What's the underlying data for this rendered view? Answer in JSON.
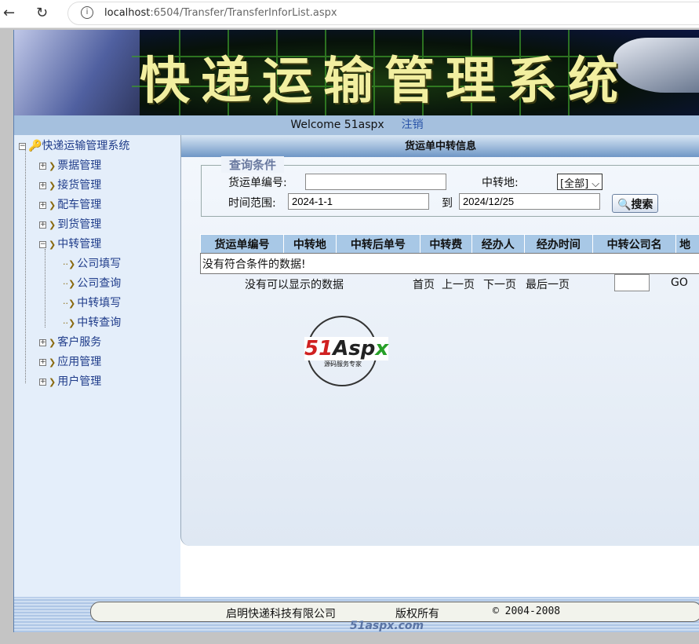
{
  "browser": {
    "url_host": "localhost",
    "url_path": ":6504/Transfer/TransferInforList.aspx"
  },
  "banner": {
    "title": "快递运输管理系统"
  },
  "welcome": {
    "text": "Welcome 51aspx",
    "logout": "注销"
  },
  "sidebar": {
    "root": "快递运输管理系统",
    "items": [
      {
        "label": "票据管理"
      },
      {
        "label": "接货管理"
      },
      {
        "label": "配车管理"
      },
      {
        "label": "到货管理"
      },
      {
        "label": "中转管理"
      },
      {
        "label": "公司填写"
      },
      {
        "label": "公司查询"
      },
      {
        "label": "中转填写"
      },
      {
        "label": "中转查询"
      },
      {
        "label": "客户服务"
      },
      {
        "label": "应用管理"
      },
      {
        "label": "用户管理"
      }
    ]
  },
  "main": {
    "title": "货运单中转信息",
    "query": {
      "legend": "查询条件",
      "order_label": "货运单编号:",
      "order_value": "",
      "place_label": "中转地:",
      "place_value": "[全部]",
      "range_label": "时间范围:",
      "from": "2024-1-1",
      "to_label": "到",
      "to": "2024/12/25",
      "search": "搜索"
    },
    "table": {
      "headers": [
        "货运单编号",
        "中转地",
        "中转后单号",
        "中转费",
        "经办人",
        "经办时间",
        "中转公司名",
        "地"
      ],
      "empty": "没有符合条件的数据!"
    },
    "pager": {
      "info": "没有可以显示的数据",
      "first": "首页",
      "prev": "上一页",
      "next": "下一页",
      "last": "最后一页",
      "page_input": "",
      "go": "GO"
    },
    "logo": {
      "text": "51Aspx",
      "sub": "源码服务专家"
    }
  },
  "footer": {
    "company": "启明快递科技有限公司",
    "rights": "版权所有",
    "copyright": "© 2004-2008",
    "watermark": "51aspx.com"
  }
}
